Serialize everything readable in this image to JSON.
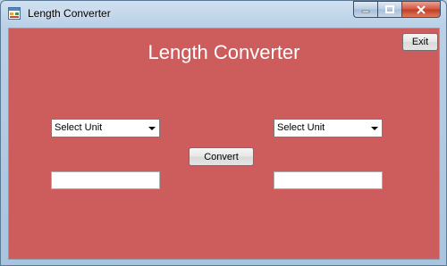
{
  "window": {
    "title": "Length Converter",
    "caption_buttons": {
      "minimize": "—",
      "maximize": "□",
      "close": "✕"
    }
  },
  "form": {
    "heading": "Length Converter",
    "exit_label": "Exit",
    "from_unit": {
      "selected": "Select Unit"
    },
    "to_unit": {
      "selected": "Select Unit"
    },
    "convert_label": "Convert",
    "from_value": {
      "value": ""
    },
    "to_value": {
      "value": ""
    }
  },
  "colors": {
    "form_background": "#cd5c5c",
    "heading_text": "#ffffff"
  },
  "icons": {
    "app": "app-window-icon",
    "dropdown": "chevron-down-icon"
  }
}
